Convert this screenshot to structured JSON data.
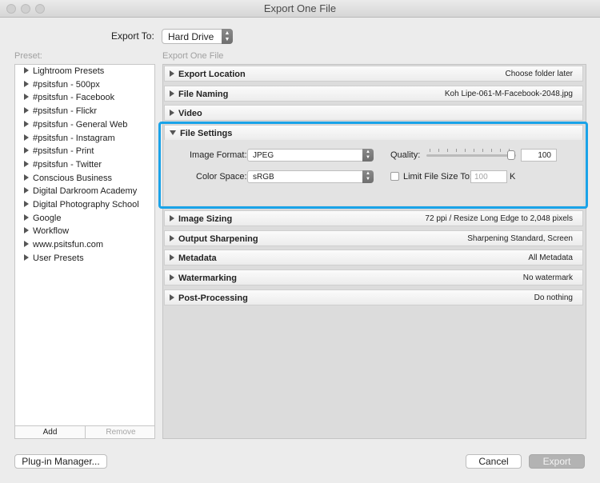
{
  "window": {
    "title": "Export One File"
  },
  "export_to": {
    "label": "Export To:",
    "value": "Hard Drive"
  },
  "preset": {
    "label": "Preset:",
    "items": [
      "Lightroom Presets",
      "#psitsfun - 500px",
      "#psitsfun - Facebook",
      "#psitsfun - Flickr",
      "#psitsfun - General Web",
      "#psitsfun - Instagram",
      "#psitsfun - Print",
      "#psitsfun - Twitter",
      "Conscious Business",
      "Digital Darkroom Academy",
      "Digital Photography School",
      "Google",
      "Workflow",
      "www.psitsfun.com",
      "User Presets"
    ],
    "add_label": "Add",
    "remove_label": "Remove"
  },
  "panel_heading": "Export One File",
  "sections": [
    {
      "title": "Export Location",
      "summary": "Choose folder later"
    },
    {
      "title": "File Naming",
      "summary": "Koh Lipe-061-M-Facebook-2048.jpg"
    },
    {
      "title": "Video",
      "summary": ""
    },
    {
      "title": "File Settings",
      "summary": ""
    },
    {
      "title": "Image Sizing",
      "summary": "72 ppi / Resize Long Edge to 2,048 pixels"
    },
    {
      "title": "Output Sharpening",
      "summary": "Sharpening Standard, Screen"
    },
    {
      "title": "Metadata",
      "summary": "All Metadata"
    },
    {
      "title": "Watermarking",
      "summary": "No watermark"
    },
    {
      "title": "Post-Processing",
      "summary": "Do nothing"
    }
  ],
  "file_settings": {
    "image_format_label": "Image Format:",
    "image_format_value": "JPEG",
    "quality_label": "Quality:",
    "quality_value": "100",
    "color_space_label": "Color Space:",
    "color_space_value": "sRGB",
    "limit_label": "Limit File Size To:",
    "limit_value": "100",
    "limit_unit": "K"
  },
  "buttons": {
    "plugin_manager": "Plug-in Manager...",
    "cancel": "Cancel",
    "export": "Export"
  },
  "colors": {
    "highlight": "#1aa3e8"
  }
}
